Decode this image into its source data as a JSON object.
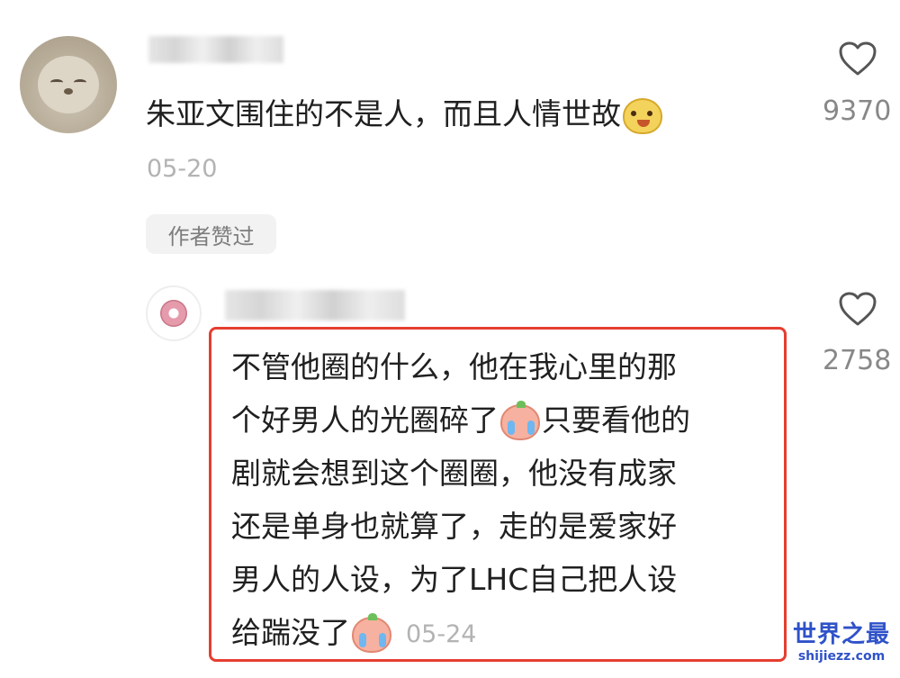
{
  "comments": [
    {
      "username": "",
      "text": "朱亚文围住的不是人，而且人情世故",
      "emoji": "dog-face-emoji",
      "date": "05-20",
      "like_count": "9370",
      "author_badge": "作者赞过"
    },
    {
      "username": "",
      "lines": [
        "不管他圈的什么，他在我心里的那",
        "个好男人的光圈碎了",
        "只要看他的",
        "剧就会想到这个圈圈，他没有成家",
        "还是单身也就算了，走的是爱家好",
        "男人的人设，为了LHC自己把人设",
        "给踹没了"
      ],
      "date": "05-24",
      "like_count": "2758",
      "highlight_color": "#e53e30"
    }
  ],
  "icons": {
    "like": "heart-outline-icon",
    "emoji_1": "dog-face-emoji",
    "emoji_2": "crying-face-emoji"
  },
  "watermark": {
    "main": "世界之最",
    "url": "shijiezz.com"
  }
}
